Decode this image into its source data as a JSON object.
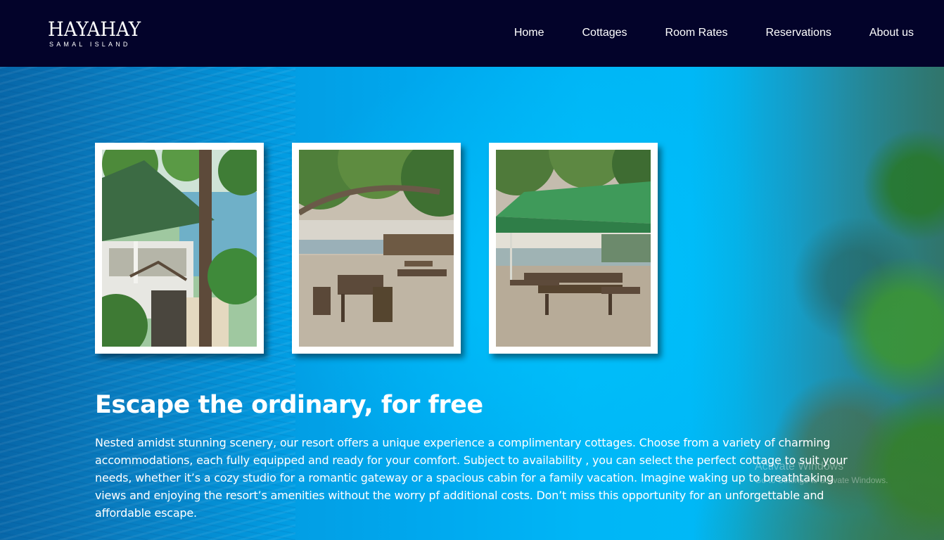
{
  "header": {
    "logo_title": "HAYAHAY",
    "logo_subtitle": "SAMAL ISLAND",
    "nav": [
      {
        "label": "Home"
      },
      {
        "label": "Cottages"
      },
      {
        "label": "Room Rates"
      },
      {
        "label": "Reservations"
      },
      {
        "label": "About us"
      }
    ]
  },
  "gallery": {
    "photos": [
      {
        "subject": "open-air cottage with green roof under palm tree by the sea"
      },
      {
        "subject": "wooden table and chairs on pebble beach under trees"
      },
      {
        "subject": "picnic tables under green canopy tent by the shore"
      }
    ]
  },
  "content": {
    "headline": "Escape the ordinary, for free",
    "body": "Nested amidst stunning scenery, our resort offers a unique experience a complimentary cottages. Choose from a variety of charming accommodations, each fully equipped and ready for your comfort. Subject to availability , you can select the perfect cottage to suit your needs, whether it’s a cozy studio for a romantic gateway or a spacious cabin for a family vacation. Imagine waking up to breathtaking views and enjoying the resort’s amenities without the worry pf additional costs. Don’t miss this opportunity for an unforgettable and affordable escape."
  },
  "watermark": {
    "title": "Activate Windows",
    "subtitle": "Go to Settings to activate Windows."
  },
  "colors": {
    "header_bg": "#03032a",
    "hero_accent": "#00b4f0",
    "text": "#ffffff"
  }
}
